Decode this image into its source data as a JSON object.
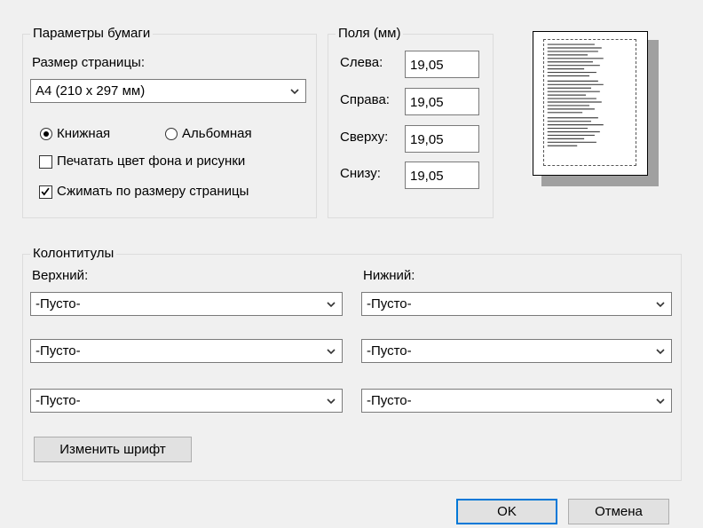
{
  "paper": {
    "legend": "Параметры бумаги",
    "size_label": "Размер страницы:",
    "size_value": "A4 (210 x 297 мм)",
    "orientation": {
      "portrait_label": "Книжная",
      "landscape_label": "Альбомная",
      "selected": "portrait"
    },
    "print_bg_label": "Печатать цвет фона и рисунки",
    "print_bg_checked": false,
    "shrink_label": "Сжимать по размеру страницы",
    "shrink_checked": true
  },
  "margins": {
    "legend": "Поля (мм)",
    "left_label": "Слева:",
    "left_value": "19,05",
    "right_label": "Справа:",
    "right_value": "19,05",
    "top_label": "Сверху:",
    "top_value": "19,05",
    "bottom_label": "Снизу:",
    "bottom_value": "19,05"
  },
  "headers_footers": {
    "legend": "Колонтитулы",
    "header_label": "Верхний:",
    "footer_label": "Нижний:",
    "header_values": [
      "-Пусто-",
      "-Пусто-",
      "-Пусто-"
    ],
    "footer_values": [
      "-Пусто-",
      "-Пусто-",
      "-Пусто-"
    ],
    "font_button": "Изменить шрифт"
  },
  "buttons": {
    "ok": "OK",
    "cancel": "Отмена"
  },
  "colors": {
    "accent_border": "#0078d7",
    "dialog_bg": "#f0f0f0"
  }
}
